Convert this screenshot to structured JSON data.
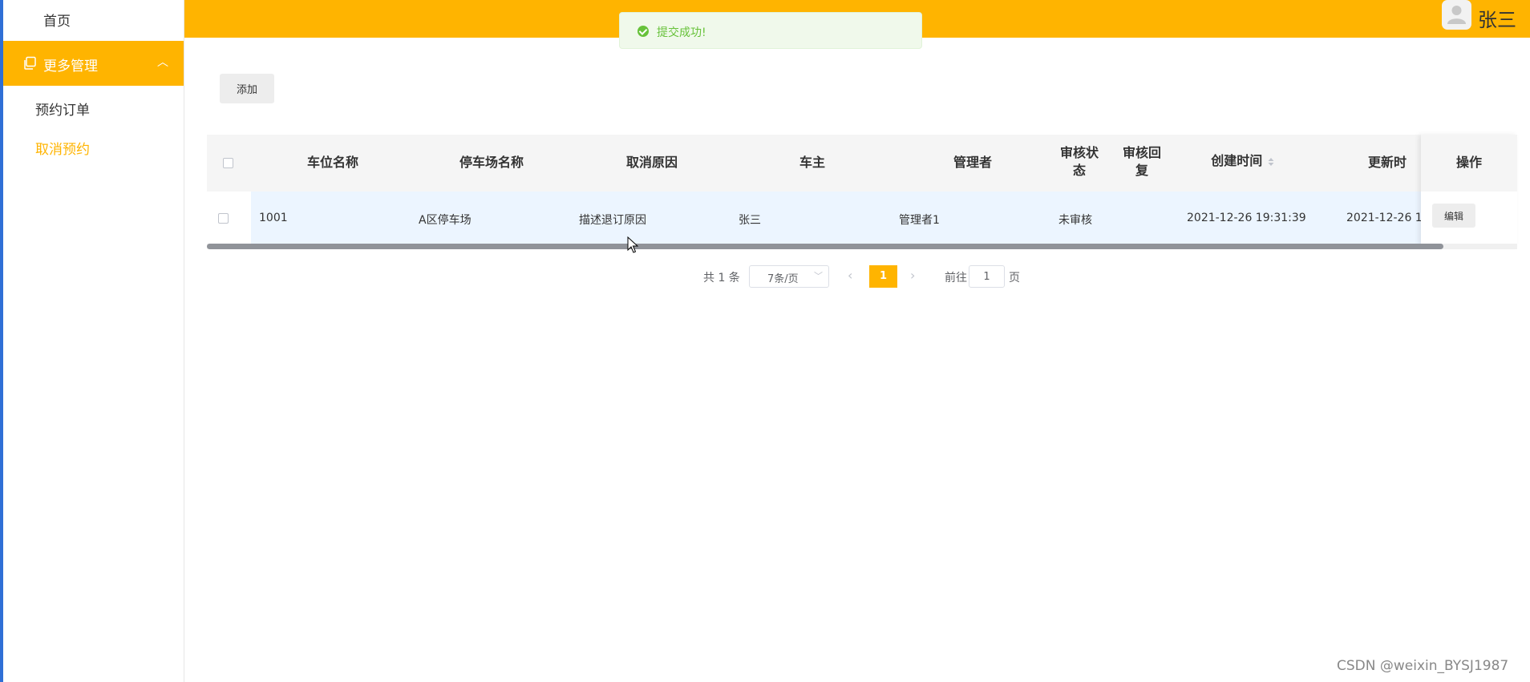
{
  "sidebar": {
    "home": "首页",
    "group_label": "更多管理",
    "group_icon": "copy-icon",
    "items": [
      {
        "label": "预约订单",
        "active": false
      },
      {
        "label": "取消预约",
        "active": true
      }
    ]
  },
  "header": {
    "username": "张三",
    "avatar_icon": "user-avatar-icon"
  },
  "toast": {
    "text": "提交成功!",
    "icon": "check-circle-icon"
  },
  "toolbar": {
    "add_label": "添加"
  },
  "table": {
    "columns": [
      "车位名称",
      "停车场名称",
      "取消原因",
      "车主",
      "管理者",
      "审核状态",
      "审核回复",
      "创建时间",
      "更新时",
      "操作"
    ],
    "rows": [
      {
        "space_name": "1001",
        "lot_name": "A区停车场",
        "reason": "描述退订原因",
        "owner": "张三",
        "manager": "管理者1",
        "status": "未审核",
        "reply": "",
        "created": "2021-12-26 19:31:39",
        "updated": "2021-12-26 1",
        "action": "编辑"
      }
    ]
  },
  "pagination": {
    "total": "共 1 条",
    "page_size": "7条/页",
    "current_page": "1",
    "goto_label": "前往",
    "goto_value": "1",
    "page_suffix": "页"
  },
  "watermark": "CSDN @weixin_BYSJ1987",
  "colors": {
    "accent": "#ffb400",
    "success": "#67c23a",
    "sidebar_edge": "#2f6fd6"
  }
}
